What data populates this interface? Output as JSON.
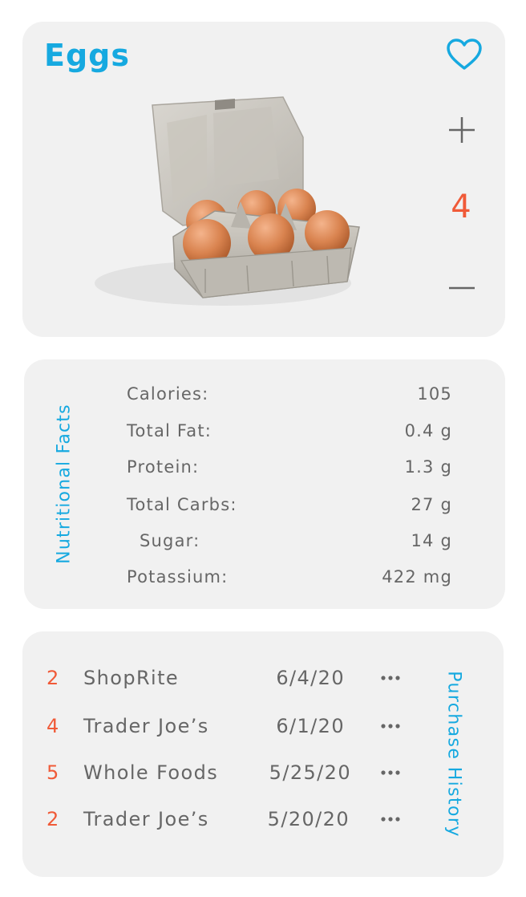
{
  "product": {
    "name": "Eggs",
    "quantity": "4",
    "favorite": true,
    "image_alt": "carton of six brown eggs"
  },
  "colors": {
    "accent_blue": "#16a9e0",
    "accent_orange": "#f05a38",
    "card_bg": "#f1f1f1",
    "text_gray": "#666666"
  },
  "nutrition": {
    "label": "Nutritional Facts",
    "items": [
      {
        "label": "Calories:",
        "value": "105"
      },
      {
        "label": "Total Fat:",
        "value": "0.4 g"
      },
      {
        "label": "Protein:",
        "value": "1.3 g"
      },
      {
        "label": "Total Carbs:",
        "value": "27 g"
      },
      {
        "label": "Sugar:",
        "value": "14 g"
      },
      {
        "label": "Potassium:",
        "value": "422 mg"
      }
    ]
  },
  "purchase_history": {
    "label": "Purchase History",
    "items": [
      {
        "qty": "2",
        "store": "ShopRite",
        "date": "6/4/20"
      },
      {
        "qty": "4",
        "store": "Trader Joe’s",
        "date": "6/1/20"
      },
      {
        "qty": "5",
        "store": "Whole Foods",
        "date": "5/25/20"
      },
      {
        "qty": "2",
        "store": "Trader Joe’s",
        "date": "5/20/20"
      }
    ]
  },
  "icons": {
    "favorite": "heart-icon",
    "increment": "plus-icon",
    "decrement": "minus-icon",
    "more": "more-horizontal-icon"
  }
}
